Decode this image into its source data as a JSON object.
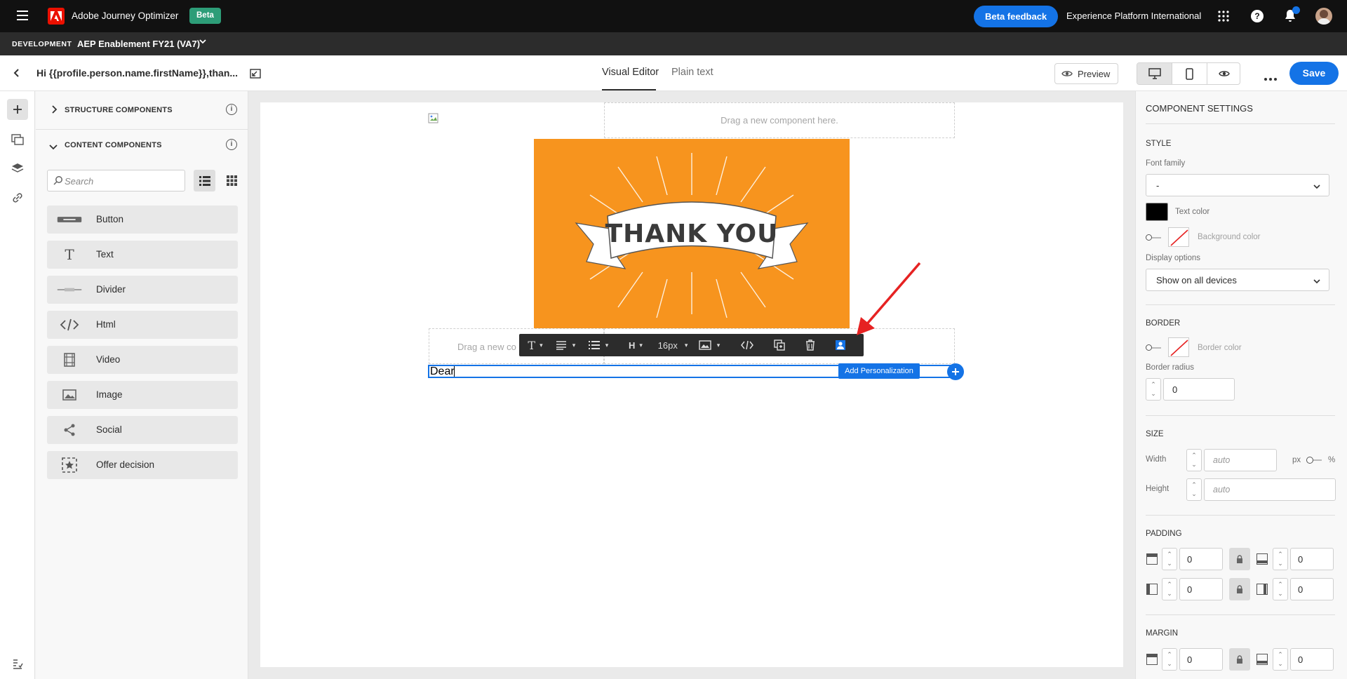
{
  "app": {
    "title": "Adobe Journey Optimizer",
    "badge": "Beta",
    "feedback_button": "Beta feedback",
    "org_name": "Experience Platform International",
    "brand_color": "#eb1000",
    "accent_color": "#1473e6",
    "badge_color": "#2d9d78"
  },
  "env": {
    "label": "DEVELOPMENT",
    "sandbox": "AEP Enablement FY21 (VA7)"
  },
  "doc": {
    "title": "Hi {{profile.person.name.firstName}},than...",
    "tabs": [
      "Visual Editor",
      "Plain text"
    ],
    "active_tab": "Visual Editor",
    "preview_label": "Preview",
    "save_label": "Save"
  },
  "left_panel": {
    "structure_title": "STRUCTURE COMPONENTS",
    "content_title": "CONTENT COMPONENTS",
    "search_placeholder": "Search",
    "components": [
      {
        "label": "Button",
        "icon": "button-icon"
      },
      {
        "label": "Text",
        "icon": "text-icon"
      },
      {
        "label": "Divider",
        "icon": "divider-icon"
      },
      {
        "label": "Html",
        "icon": "code-icon"
      },
      {
        "label": "Video",
        "icon": "video-icon"
      },
      {
        "label": "Image",
        "icon": "image-icon"
      },
      {
        "label": "Social",
        "icon": "share-icon"
      },
      {
        "label": "Offer decision",
        "icon": "offer-decision-icon"
      }
    ]
  },
  "canvas": {
    "drop_hint_top": "Drag a new component here.",
    "drop_hint_left": "Drag a new co",
    "hero_text": "THANK YOU",
    "hero_color": "#f7941e",
    "text_value": "Dear",
    "toolbar": {
      "font_size": "16px",
      "heading_label": "H"
    },
    "tooltip": "Add Personalization"
  },
  "settings": {
    "title": "COMPONENT SETTINGS",
    "style_title": "STYLE",
    "font_family_label": "Font family",
    "font_family_value": "-",
    "text_color_label": "Text color",
    "text_color": "#000000",
    "bg_color_label": "Background color",
    "display_options_label": "Display options",
    "display_options_value": "Show on all devices",
    "border_title": "BORDER",
    "border_color_label": "Border color",
    "border_radius_label": "Border radius",
    "border_radius_value": "0",
    "size_title": "SIZE",
    "width_label": "Width",
    "width_placeholder": "auto",
    "unit_px": "px",
    "unit_pct": "%",
    "height_label": "Height",
    "height_placeholder": "auto",
    "padding_title": "PADDING",
    "padding": {
      "top": "0",
      "bottom": "0",
      "left": "0",
      "right": "0"
    },
    "margin_title": "MARGIN",
    "margin": {
      "top": "0",
      "bottom": "0"
    }
  }
}
